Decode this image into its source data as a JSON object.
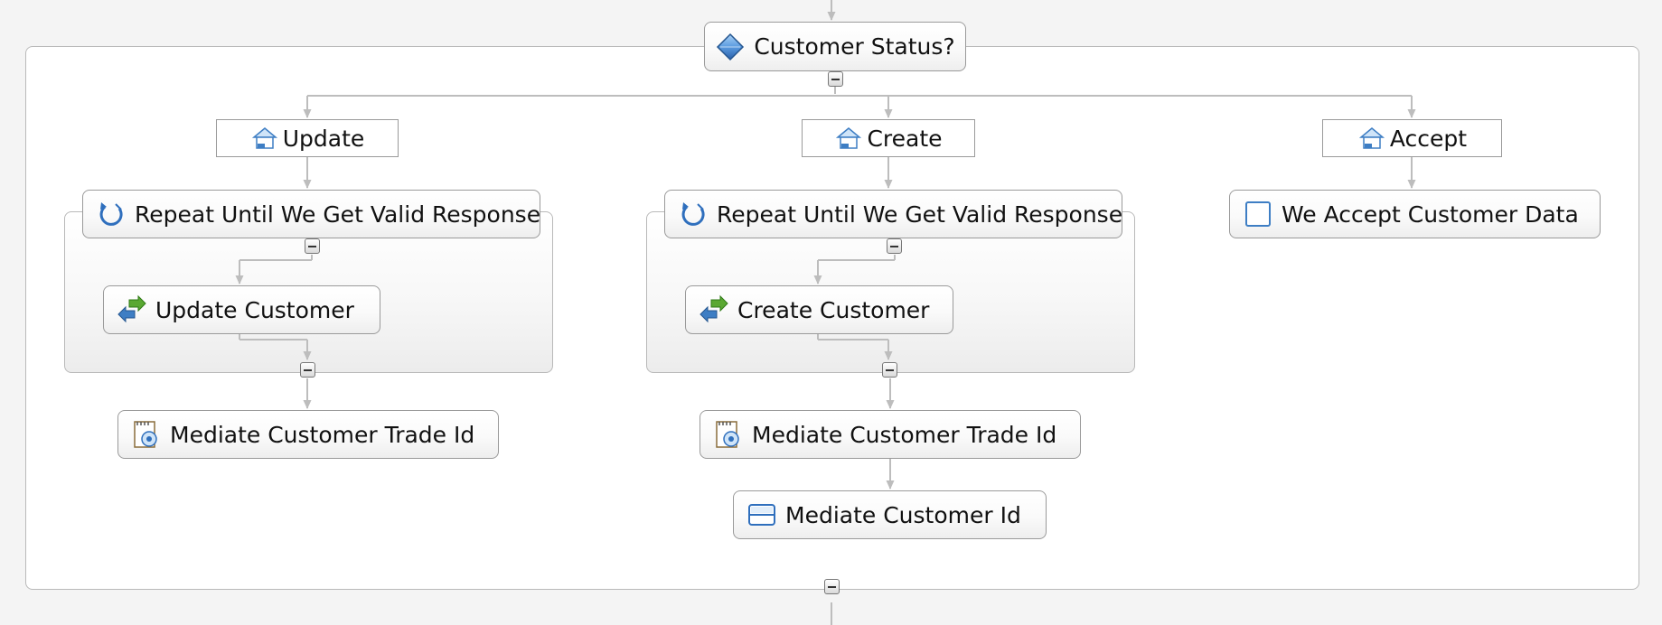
{
  "decision": {
    "label": "Customer Status?",
    "icon": "diamond-icon"
  },
  "cases": [
    {
      "id": "update",
      "label": "Update",
      "icon": "case-icon",
      "loop": {
        "label": "Repeat Until We Get Valid Response",
        "icon": "repeat-icon"
      },
      "invoke": {
        "label": "Update Customer",
        "icon": "invoke-icon"
      },
      "steps": [
        {
          "label": "Mediate Customer Trade Id",
          "icon": "mediation-icon"
        }
      ]
    },
    {
      "id": "create",
      "label": "Create",
      "icon": "case-icon",
      "loop": {
        "label": "Repeat Until We Get Valid Response",
        "icon": "repeat-icon"
      },
      "invoke": {
        "label": "Create Customer",
        "icon": "invoke-icon"
      },
      "steps": [
        {
          "label": "Mediate Customer Trade Id",
          "icon": "mediation-icon"
        },
        {
          "label": "Mediate Customer Id",
          "icon": "data-map-icon"
        }
      ]
    },
    {
      "id": "accept",
      "label": "Accept",
      "icon": "case-icon",
      "steps": [
        {
          "label": "We Accept Customer Data",
          "icon": "empty-action-icon"
        }
      ]
    }
  ],
  "colors": {
    "connector": "#bdbdbd",
    "frame_border": "#b9b9b9",
    "node_border": "#9a9a9a",
    "icon_blue": "#3e7ec4",
    "icon_green": "#5aa832"
  }
}
